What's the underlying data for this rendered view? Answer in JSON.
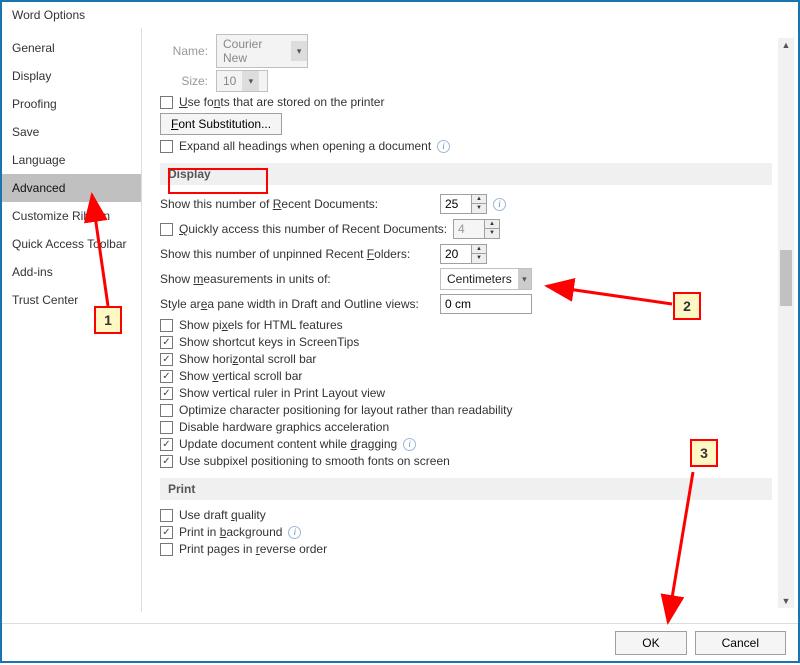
{
  "window": {
    "title": "Word Options"
  },
  "sidebar": {
    "items": [
      {
        "label": "General"
      },
      {
        "label": "Display"
      },
      {
        "label": "Proofing"
      },
      {
        "label": "Save"
      },
      {
        "label": "Language"
      },
      {
        "label": "Advanced",
        "selected": true
      },
      {
        "label": "Customize Ribbon"
      },
      {
        "label": "Quick Access Toolbar"
      },
      {
        "label": "Add-ins"
      },
      {
        "label": "Trust Center"
      }
    ]
  },
  "font_section": {
    "name_label": "Name:",
    "name_value": "Courier New",
    "size_label": "Size:",
    "size_value": "10",
    "cb_use_printer_fonts": "Use fonts that are stored on the printer",
    "btn_font_sub": "Font Substitution...",
    "cb_expand_headings": "Expand all headings when opening a document"
  },
  "display_section": {
    "heading": "Display",
    "recent_docs_label": "Show this number of Recent Documents:",
    "recent_docs_value": "25",
    "quick_access_label": "Quickly access this number of Recent Documents:",
    "quick_access_value": "4",
    "recent_folders_label": "Show this number of unpinned Recent Folders:",
    "recent_folders_value": "20",
    "units_label": "Show measurements in units of:",
    "units_value": "Centimeters",
    "style_area_label": "Style area pane width in Draft and Outline views:",
    "style_area_value": "0 cm",
    "cb_pixels_html": "Show pixels for HTML features",
    "cb_shortcut_keys": "Show shortcut keys in ScreenTips",
    "cb_hscroll": "Show horizontal scroll bar",
    "cb_vscroll": "Show vertical scroll bar",
    "cb_vruler": "Show vertical ruler in Print Layout view",
    "cb_optimize": "Optimize character positioning for layout rather than readability",
    "cb_disable_hw": "Disable hardware graphics acceleration",
    "cb_update_drag": "Update document content while dragging",
    "cb_subpixel": "Use subpixel positioning to smooth fonts on screen"
  },
  "print_section": {
    "heading": "Print",
    "cb_draft": "Use draft quality",
    "cb_background": "Print in background",
    "cb_reverse": "Print pages in reverse order"
  },
  "footer": {
    "ok": "OK",
    "cancel": "Cancel"
  },
  "annotations": {
    "m1": "1",
    "m2": "2",
    "m3": "3"
  }
}
